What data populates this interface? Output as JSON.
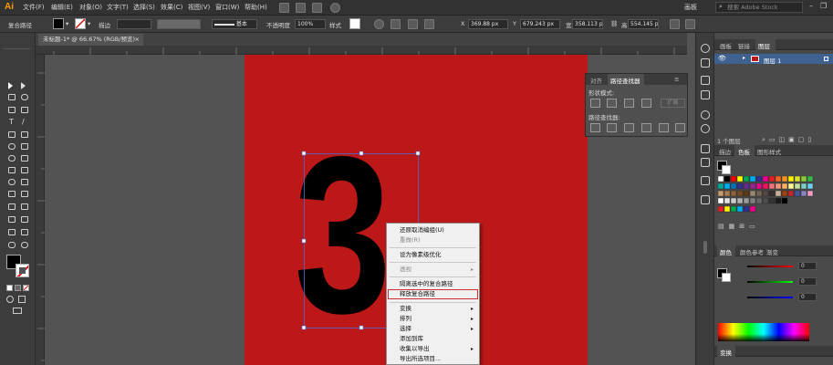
{
  "app": {
    "logo": "Ai"
  },
  "menu": [
    "文件(F)",
    "编辑(E)",
    "对象(O)",
    "文字(T)",
    "选择(S)",
    "效果(C)",
    "视图(V)",
    "窗口(W)",
    "帮助(H)"
  ],
  "workspace": "画板",
  "stock_search_placeholder": "搜索 Adobe Stock",
  "control": {
    "mode": "复合路径",
    "stroke_label": "描边",
    "stroke_profile": "基本",
    "opacity_label": "不透明度",
    "opacity": "100%",
    "style_label": "样式",
    "x_label": "X",
    "x": "369.88 px",
    "y_label": "Y",
    "y": "679.243 px",
    "w_label": "宽",
    "w": "358.113 px",
    "h_label": "高",
    "h": "554.145 px"
  },
  "doc_tab": {
    "title": "未标题-1* @ 66.67% (RGB/预览)",
    "close": "×"
  },
  "artwork": {
    "glyph": "3"
  },
  "pathfinder": {
    "tabs": [
      "对齐",
      "路径查找器"
    ],
    "shape_modes_label": "形状模式:",
    "pathfinders_label": "路径查找器:",
    "expand": "扩展"
  },
  "context_menu": [
    {
      "label": "还原取消编组(U)",
      "disabled": false
    },
    {
      "label": "重做(R)",
      "disabled": true
    },
    {
      "sep": true
    },
    {
      "label": "设为像素级优化",
      "disabled": false
    },
    {
      "sep": true
    },
    {
      "label": "透视",
      "disabled": true,
      "submenu": true
    },
    {
      "sep": true
    },
    {
      "label": "隔离选中的复合路径",
      "disabled": false
    },
    {
      "label": "释放复合路径",
      "disabled": false,
      "highlight": true
    },
    {
      "sep": true
    },
    {
      "label": "变换",
      "disabled": false,
      "submenu": true
    },
    {
      "label": "排列",
      "disabled": false,
      "submenu": true
    },
    {
      "label": "选择",
      "disabled": false,
      "submenu": true
    },
    {
      "label": "添加到库",
      "disabled": false
    },
    {
      "label": "收集以导出",
      "disabled": false,
      "submenu": true
    },
    {
      "label": "导出所选项目...",
      "disabled": false
    }
  ],
  "right_panels": {
    "top_tabs": [
      "画板",
      "链接",
      "图层"
    ],
    "layer_name": "图层 1",
    "layers_count": "1 个图层",
    "swatch_tabs": [
      "描边",
      "色板",
      "图形样式"
    ],
    "color_tabs": [
      "颜色",
      "颜色参考",
      "渐变"
    ],
    "transform_tab": "变换",
    "color_values": [
      "0",
      "0",
      "0"
    ]
  },
  "colors": {
    "artboard": "#bb1817",
    "accent": "#ff9a00",
    "selection": "#4a6cd4"
  }
}
